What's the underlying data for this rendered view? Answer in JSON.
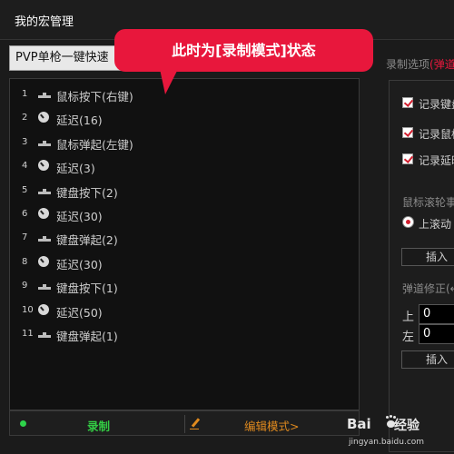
{
  "window": {
    "title": "我的宏管理"
  },
  "preset": {
    "selected": "PVP单枪一键快速"
  },
  "callout": {
    "text": "此时为[录制模式]状态"
  },
  "macro_list": [
    {
      "num": "1",
      "icon": "key-icon",
      "label": "鼠标按下(右键)"
    },
    {
      "num": "2",
      "icon": "clock-icon",
      "label": "延迟(16)"
    },
    {
      "num": "3",
      "icon": "key-icon",
      "label": "鼠标弹起(左键)"
    },
    {
      "num": "4",
      "icon": "clock-icon",
      "label": "延迟(3)"
    },
    {
      "num": "5",
      "icon": "key-icon",
      "label": "键盘按下(2)"
    },
    {
      "num": "6",
      "icon": "clock-icon",
      "label": "延迟(30)"
    },
    {
      "num": "7",
      "icon": "key-icon",
      "label": "键盘弹起(2)"
    },
    {
      "num": "8",
      "icon": "clock-icon",
      "label": "延迟(30)"
    },
    {
      "num": "9",
      "icon": "key-icon",
      "label": "键盘按下(1)"
    },
    {
      "num": "10",
      "icon": "clock-icon",
      "label": "延迟(50)"
    },
    {
      "num": "11",
      "icon": "key-icon",
      "label": "键盘弹起(1)"
    }
  ],
  "bottom_bar": {
    "record_label": "录制",
    "edit_label": "编辑模式>"
  },
  "options": {
    "title": "录制选项",
    "title_accent": "(弹道",
    "checkboxes": [
      {
        "label": "记录键盘",
        "checked": true
      },
      {
        "label": "记录鼠标",
        "checked": true
      },
      {
        "label": "记录延时",
        "checked": true
      }
    ],
    "wheel_label": "鼠标滚轮事",
    "wheel_radio_label": "上滚动",
    "insert_label_1": "插入",
    "offset_label": "弹道修正(←",
    "offset_up_key": "上",
    "offset_up_value": "0",
    "offset_left_key": "左",
    "offset_left_value": "0",
    "insert_label_2": "插入"
  },
  "watermark": {
    "brand": "Bai",
    "sub": "经验",
    "url": "jingyan.baidu.com"
  }
}
